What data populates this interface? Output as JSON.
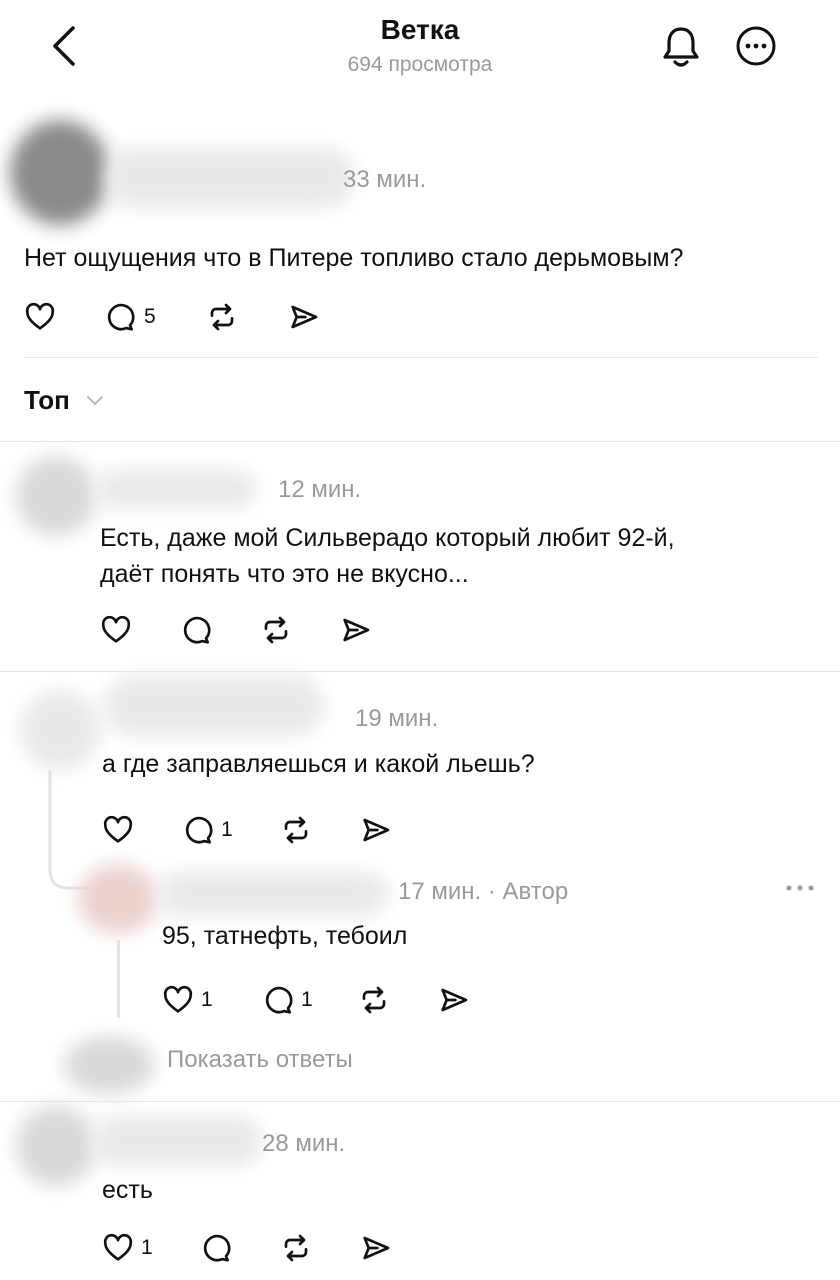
{
  "header": {
    "title": "Ветка",
    "views": "694 просмотра",
    "icons": {
      "back": "chevron-left-icon",
      "notifications": "bell-icon",
      "more": "more-circle-icon"
    }
  },
  "post": {
    "time": "33 мин.",
    "text": "Нет ощущения что в Питере топливо стало дерьмовым?",
    "reply_count": "5"
  },
  "sort": {
    "label": "Топ"
  },
  "comments": [
    {
      "time": "12 мин.",
      "text_line1": "Есть, даже мой Сильверадо который любит 92-й,",
      "text_line2": "даёт понять что это не вкусно..."
    },
    {
      "time": "19 мин.",
      "text": "а где заправляешься и какой льешь?",
      "reply_count": "1",
      "reply": {
        "meta": "17 мин. · Автор",
        "text": "95, татнефть, тебоил",
        "like_count": "1",
        "reply_count": "1"
      },
      "show_replies": "Показать ответы"
    },
    {
      "time": "28 мин.",
      "text": "есть",
      "like_count": "1"
    }
  ]
}
